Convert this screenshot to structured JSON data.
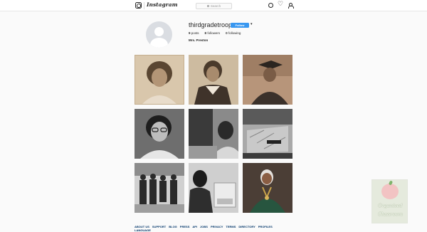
{
  "topbar": {
    "wordmark": "Instagram",
    "search_placeholder": "Search"
  },
  "profile": {
    "username": "thirdgradetroop",
    "follow_label": "Follow",
    "more_label": "▾",
    "stats": {
      "posts_count": "9",
      "posts_label": "posts",
      "followers_count": "8",
      "followers_label": "followers",
      "following_count": "0",
      "following_label": "following"
    },
    "full_name": "Mrs. Preston"
  },
  "posts": [
    {
      "id": 1,
      "tone": "sepia"
    },
    {
      "id": 2,
      "tone": "sepia"
    },
    {
      "id": 3,
      "tone": "sepia"
    },
    {
      "id": 4,
      "tone": "bw"
    },
    {
      "id": 5,
      "tone": "bw"
    },
    {
      "id": 6,
      "tone": "bw"
    },
    {
      "id": 7,
      "tone": "bw"
    },
    {
      "id": 8,
      "tone": "bw"
    },
    {
      "id": 9,
      "tone": "color"
    }
  ],
  "footer": {
    "links": [
      "ABOUT US",
      "SUPPORT",
      "BLOG",
      "PRESS",
      "API",
      "JOBS",
      "PRIVACY",
      "TERMS",
      "DIRECTORY",
      "PROFILES",
      "LANGUAGE"
    ]
  },
  "watermark": {
    "line1": "Organized",
    "line2": "Classroom"
  },
  "colors": {
    "accent": "#3897f0",
    "link": "#003569",
    "background": "#fafafa"
  }
}
